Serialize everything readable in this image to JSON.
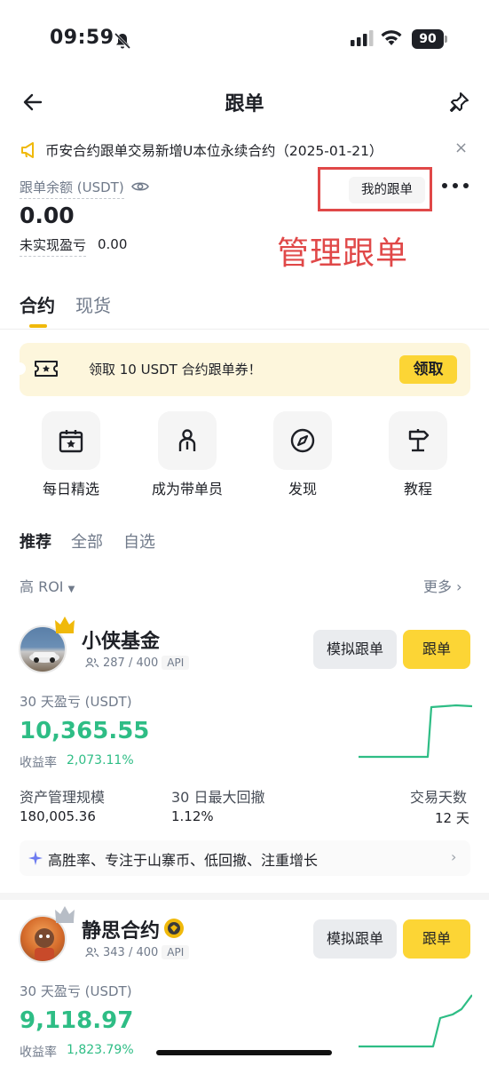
{
  "status_bar": {
    "time": "09:59",
    "battery": "90"
  },
  "header": {
    "title": "跟单"
  },
  "notice": {
    "text": "币安合约跟单交易新增U本位永续合约（2025-01-21）",
    "close": "×"
  },
  "balance": {
    "label": "跟单余额 (USDT)",
    "value": "0.00",
    "pnl_label": "未实现盈亏",
    "pnl_value": "0.00",
    "my_copy_button": "我的跟单",
    "annotation": "管理跟单"
  },
  "tabs": [
    {
      "label": "合约"
    },
    {
      "label": "现货"
    }
  ],
  "coupon": {
    "text": "领取 10 USDT 合约跟单券！",
    "button": "领取"
  },
  "shortcuts": [
    {
      "label": "每日精选",
      "icon": "calendar-icon"
    },
    {
      "label": "成为带单员",
      "icon": "person-icon"
    },
    {
      "label": "发现",
      "icon": "compass-icon"
    },
    {
      "label": "教程",
      "icon": "signpost-icon"
    }
  ],
  "filter_tabs": [
    {
      "label": "推荐"
    },
    {
      "label": "全部"
    },
    {
      "label": "自选"
    }
  ],
  "sort": {
    "label": "高 ROI",
    "more": "更多"
  },
  "traders": [
    {
      "name": "小侠基金",
      "copiers": "287 / 400",
      "api": "API",
      "sim_button": "模拟跟单",
      "copy_button": "跟单",
      "pnl_label": "30 天盈亏 (USDT)",
      "pnl": "10,365.55",
      "roi_label": "收益率",
      "roi": "2,073.11%",
      "aum_label": "资产管理规模",
      "aum": "180,005.36",
      "mdd_label": "30 日最大回撤",
      "mdd": "1.12%",
      "days_label": "交易天数",
      "days": "12 天",
      "tagline": "高胜率、专注于山寨币、低回撤、注重增长",
      "crown_color": "#f0b90b"
    },
    {
      "name": "静思合约",
      "copiers": "343 / 400",
      "api": "API",
      "sim_button": "模拟跟单",
      "copy_button": "跟单",
      "pnl_label": "30 天盈亏 (USDT)",
      "pnl": "9,118.97",
      "roi_label": "收益率",
      "roi": "1,823.79%",
      "crown_color": "#b7bdc6"
    }
  ],
  "colors": {
    "accent": "#fcd535",
    "positive": "#2ebd85",
    "annotation": "#e04848"
  }
}
